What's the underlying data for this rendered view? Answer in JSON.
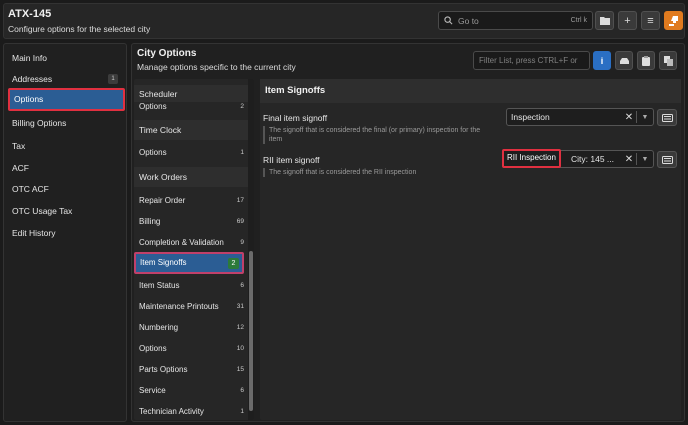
{
  "header": {
    "title": "ATX-145",
    "subtitle": "Configure options for the selected city",
    "goto_placeholder": "Go to",
    "goto_shortcut": "Ctrl k"
  },
  "nav": {
    "items": [
      {
        "label": "Main Info"
      },
      {
        "label": "Addresses",
        "badge": "1"
      },
      {
        "label": "Options",
        "active": true
      },
      {
        "label": "Billing Options"
      },
      {
        "label": "Tax"
      },
      {
        "label": "ACF"
      },
      {
        "label": "OTC ACF"
      },
      {
        "label": "OTC Usage Tax"
      },
      {
        "label": "Edit History"
      }
    ]
  },
  "main": {
    "title": "City Options",
    "subtitle": "Manage options specific to the current city",
    "filter_placeholder": "Filter List, press CTRL+F or"
  },
  "options_list": {
    "sections": [
      {
        "header": "Scheduler",
        "items": [
          {
            "label": "Options",
            "count": "2"
          }
        ]
      },
      {
        "header": "Time Clock",
        "items": [
          {
            "label": "Options",
            "count": "1"
          }
        ]
      },
      {
        "header": "Work Orders",
        "items": [
          {
            "label": "Repair Order",
            "count": "17"
          },
          {
            "label": "Billing",
            "count": "69"
          },
          {
            "label": "Completion & Validation",
            "count": "9"
          },
          {
            "label": "Item Signoffs",
            "count": "2",
            "active": true
          },
          {
            "label": "Item Status",
            "count": "6"
          },
          {
            "label": "Maintenance Printouts",
            "count": "31"
          },
          {
            "label": "Numbering",
            "count": "12"
          },
          {
            "label": "Options",
            "count": "10"
          },
          {
            "label": "Parts Options",
            "count": "15"
          },
          {
            "label": "Service",
            "count": "6"
          },
          {
            "label": "Technician Activity",
            "count": "1"
          }
        ]
      }
    ]
  },
  "detail": {
    "title": "Item Signoffs",
    "fields": [
      {
        "label": "Final item signoff",
        "help": "The signoff that is considered the final (or primary) inspection for the item",
        "value": "Inspection"
      },
      {
        "label": "RII item signoff",
        "help": "The signoff that is considered the RII inspection",
        "value_chip": "RII Inspection",
        "value": "City: 145 ..."
      }
    ]
  }
}
